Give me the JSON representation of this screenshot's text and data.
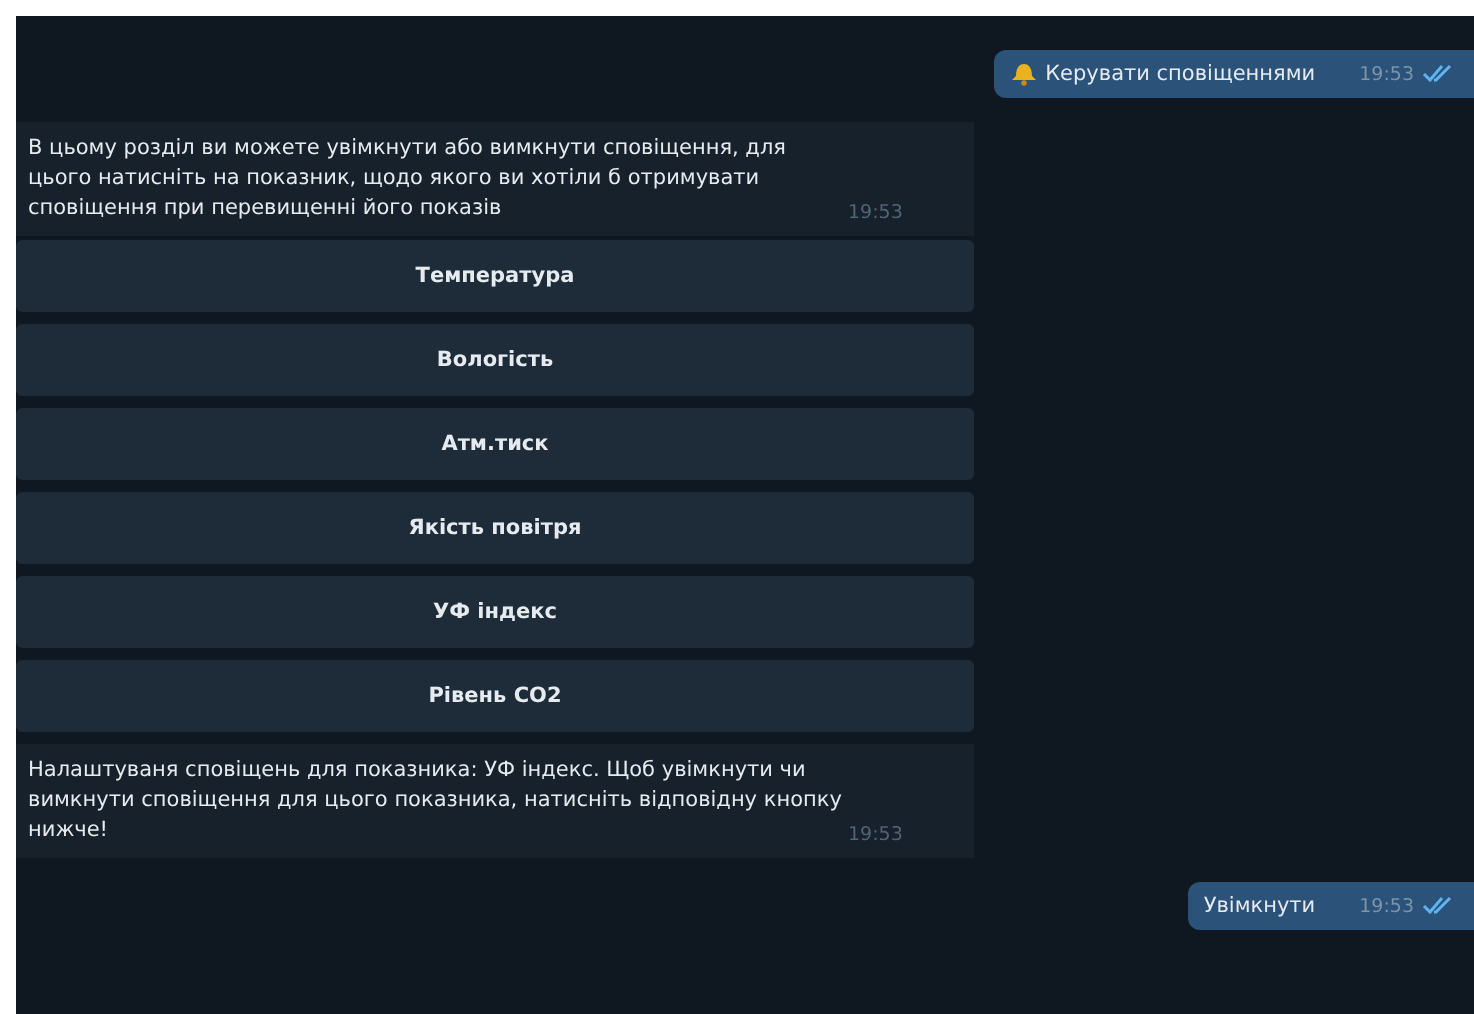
{
  "messages": [
    {
      "kind": "outgoing",
      "text": "Керувати сповіщеннями",
      "time": "19:53",
      "read": true
    },
    {
      "kind": "incoming",
      "text": "В цьому розділ ви можете увімкнути або вимкнути сповіщення, для цього натисніть на показник, щодо якого ви хотіли б отримувати сповіщення при перевищенні його показів",
      "time": "19:53"
    },
    {
      "kind": "keyboard",
      "buttons": [
        "Температура",
        "Вологість",
        "Атм.тиск",
        "Якість повітря",
        "УФ індекс",
        "Рівень CO2"
      ]
    },
    {
      "kind": "incoming",
      "text": "Налаштуваня сповіщень для показника: УФ індекс. Щоб увімкнути чи вимкнути сповіщення для цього показника, натисніть відповідну кнопку нижче!",
      "time": "19:53"
    },
    {
      "kind": "outgoing",
      "text": "Увімкнути",
      "time": "19:53",
      "read": true
    }
  ]
}
